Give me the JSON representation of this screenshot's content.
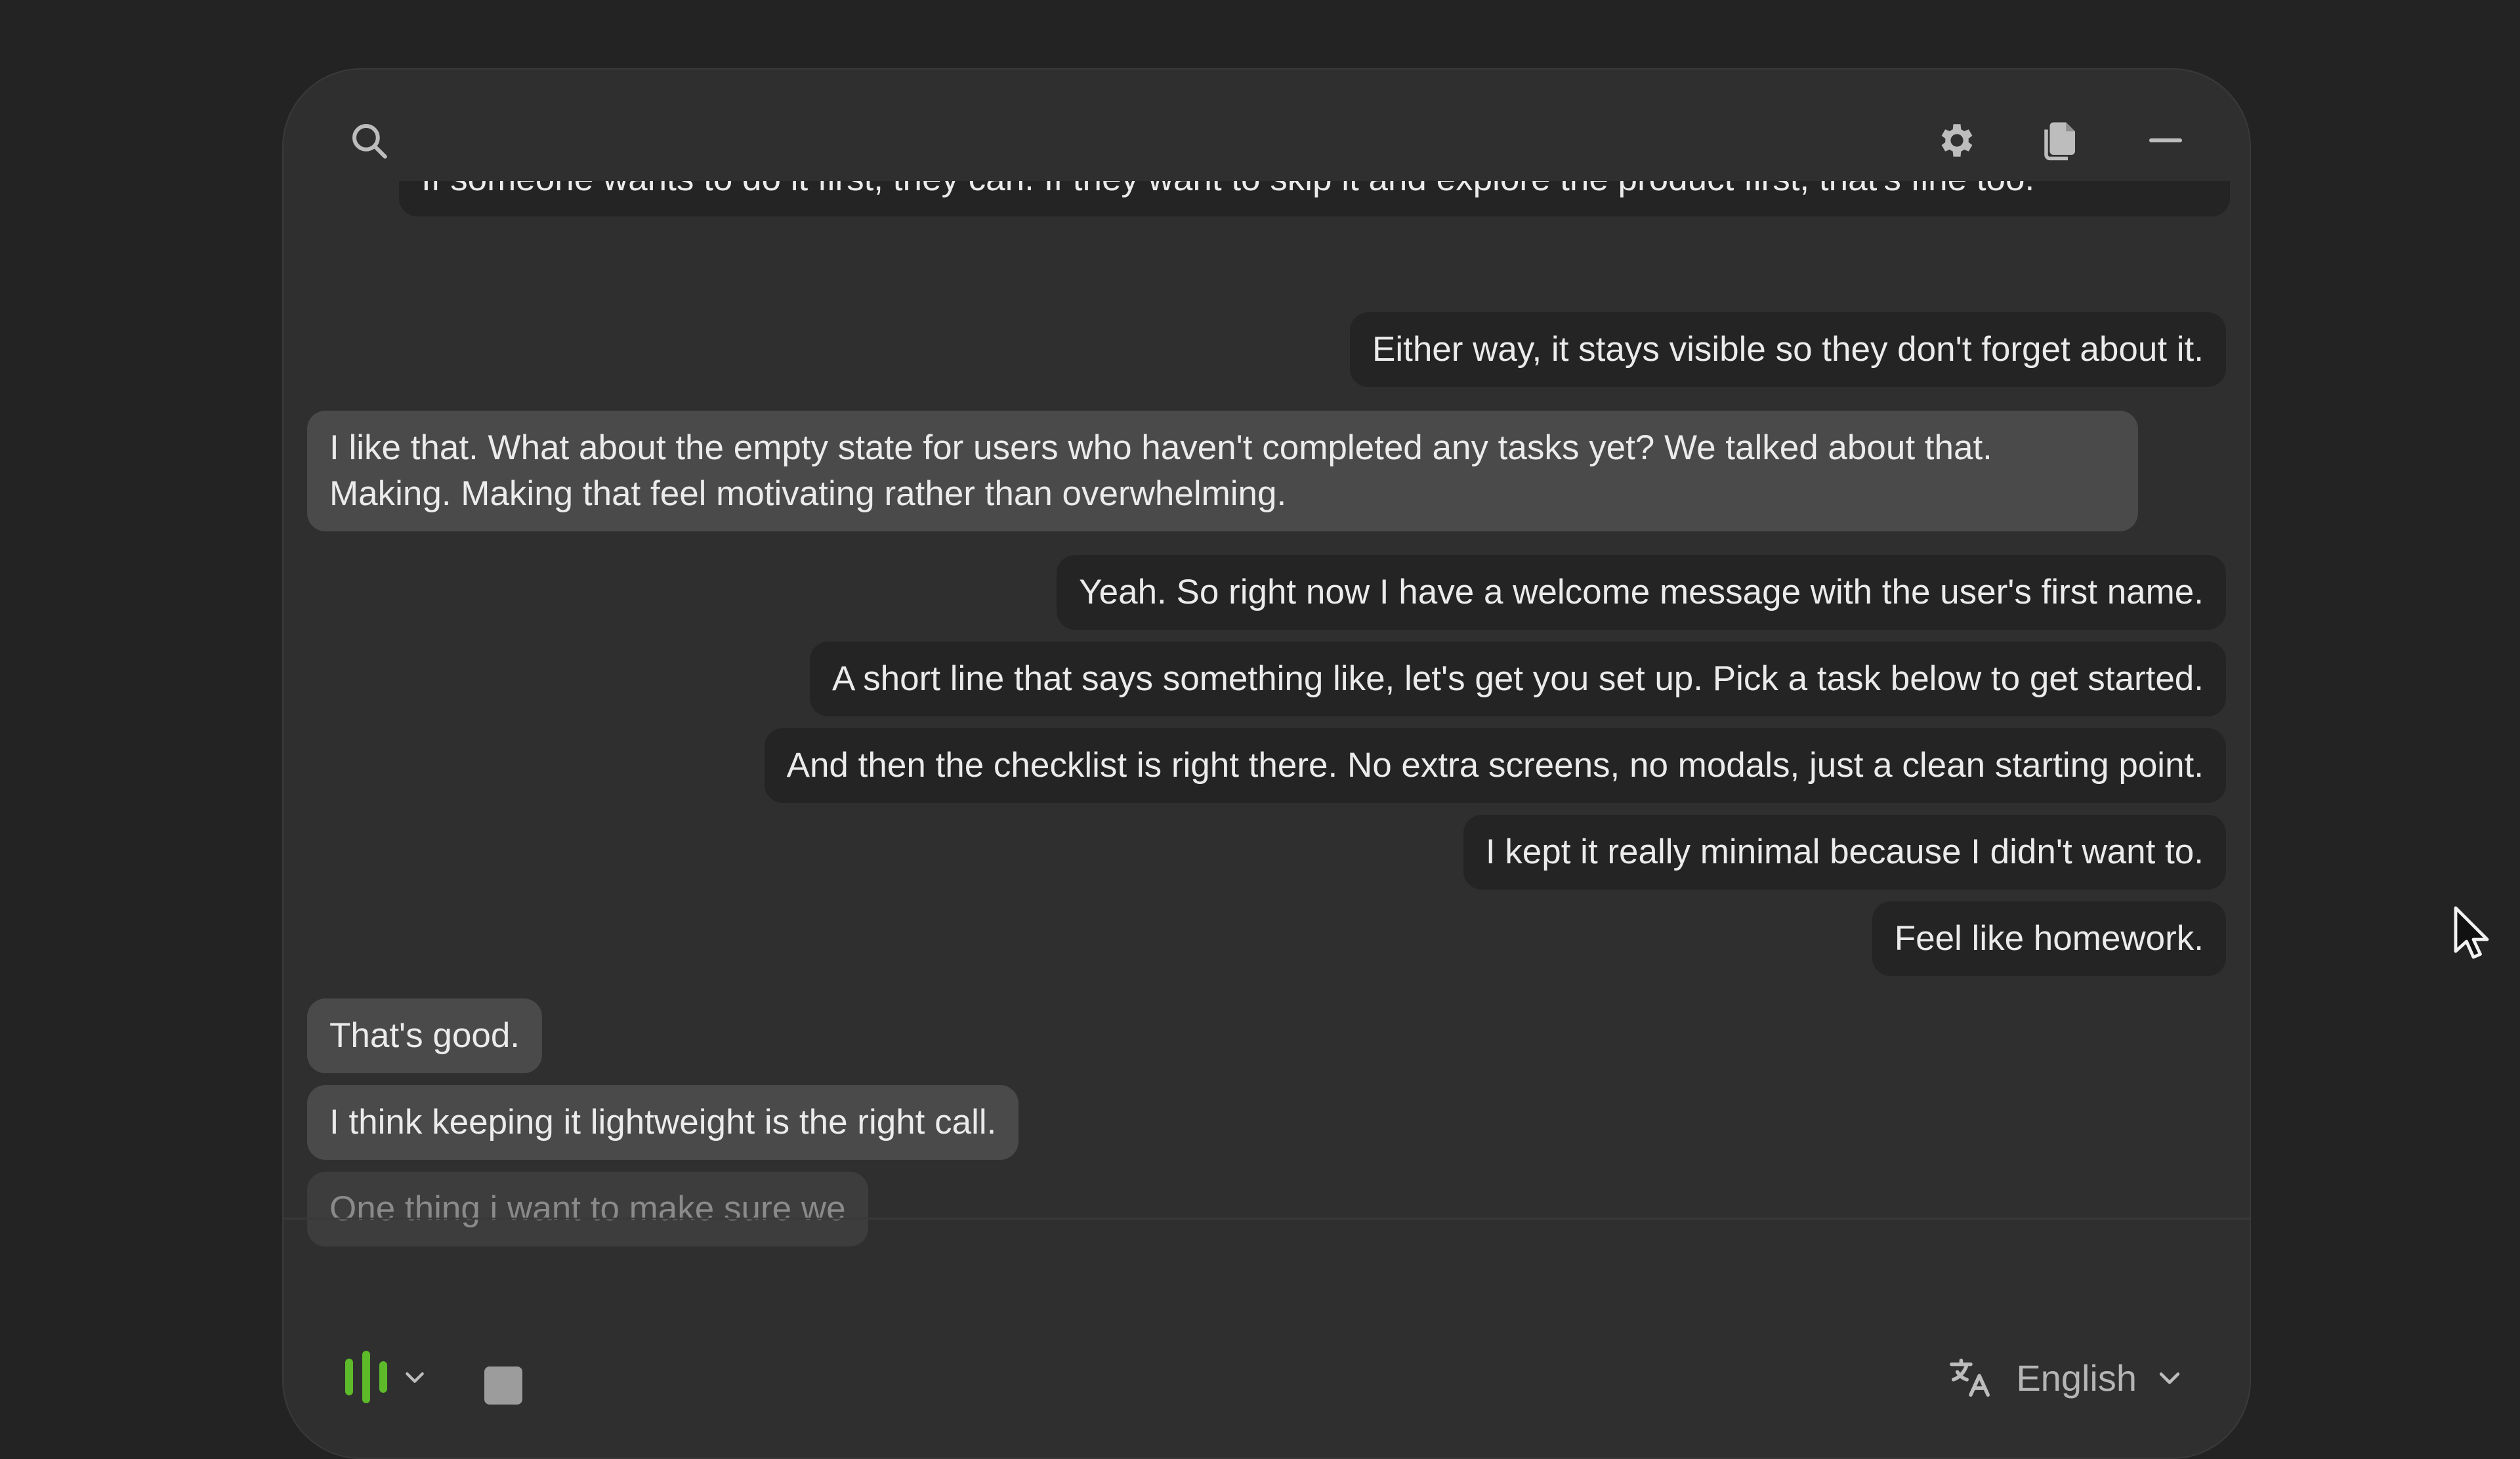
{
  "topbar": {
    "search_icon": "search-icon",
    "settings_icon": "gear-icon",
    "copy_icon": "copy-icon",
    "minimize_icon": "minimize-icon"
  },
  "messages": [
    {
      "side": "right",
      "text": "If someone wants to do it first, they can. If they want to skip it and explore the product first, that's fine too."
    },
    {
      "side": "right",
      "text": "Either way, it stays visible so they don't forget about it."
    },
    {
      "side": "left",
      "text": "I like that. What about the empty state for users who haven't completed any tasks yet? We talked about that. Making. Making that feel motivating rather than overwhelming."
    },
    {
      "side": "right",
      "text": "Yeah. So right now I have a welcome message with the user's first name."
    },
    {
      "side": "right",
      "text": "A short line that says something like, let's get you set up. Pick a task below to get started."
    },
    {
      "side": "right",
      "text": "And then the checklist is right there. No extra screens, no modals, just a clean starting point."
    },
    {
      "side": "right",
      "text": "I kept it really minimal because I didn't want to."
    },
    {
      "side": "right",
      "text": "Feel like homework."
    },
    {
      "side": "left",
      "text": "That's good."
    },
    {
      "side": "left",
      "text": "I think keeping it lightweight is the right call."
    },
    {
      "side": "left",
      "text": "One thing i want to make sure we",
      "partial": true
    }
  ],
  "bottombar": {
    "mic_icon": "audio-level-icon",
    "mic_color": "#5dbb2a",
    "stop_icon": "stop-icon",
    "language_icon": "translate-icon",
    "language": "English"
  },
  "colors": {
    "background": "#232323",
    "window": "#2f2f2f",
    "bubble_right": "#242424",
    "bubble_left": "#4a4a4a",
    "accent_green": "#5dbb2a"
  }
}
